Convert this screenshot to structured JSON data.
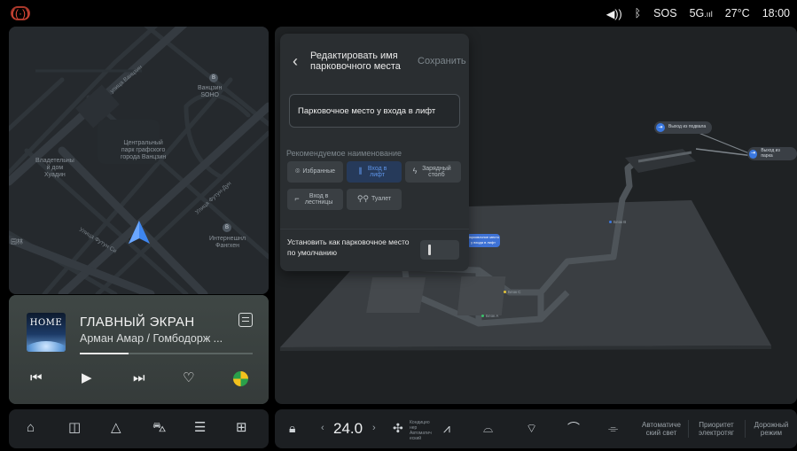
{
  "status": {
    "items": [
      "SOS",
      "5G",
      "27°C",
      "18:00"
    ]
  },
  "map": {
    "labels": {
      "wanjin_street": "улица Ванцзин",
      "soho": "Ванцзин\nSOHO",
      "park": "Центральный\nпарк графского\nгорода Ванцзин",
      "house": "Владетельны\nй дом\nХуадин",
      "futong_rd": "Улица Футун-Дун",
      "futong_west": "Улица Футун Си",
      "international": "Интернешнл\nФангхен",
      "edge_left": "园林"
    }
  },
  "music": {
    "album_text": "HOME",
    "title": "ГЛАВНЫЙ ЭКРАН",
    "artist": "Арман Амар / Гомбодорж ...",
    "progress": 0.28
  },
  "dialog": {
    "title": "Редактировать имя парковочного места",
    "save": "Сохранить",
    "input_value": "Парковочное место у входа в лифт",
    "suggested_heading": "Рекомендуемое наименование",
    "chips": [
      {
        "label": "Избранные",
        "icon": "pin-icon",
        "active": false
      },
      {
        "label": "Вход в лифт",
        "icon": "elevator-icon",
        "active": true
      },
      {
        "label": "Зарядный столб",
        "icon": "charge-icon",
        "active": false
      },
      {
        "label": "Вход в лестницы",
        "icon": "stairs-icon",
        "active": false
      },
      {
        "label": "Туалет",
        "icon": "toilet-icon",
        "active": false
      }
    ],
    "default_label": "Установить как парковочное место по умолчанию"
  },
  "parking_map": {
    "exit_basement": "Выход из подвала",
    "exit_park": "Выход из парка",
    "block_b": "Блок B",
    "block_c": "Блок C",
    "block_a": "Блок A",
    "tooltip": "Парковочное место у входа в лифт"
  },
  "climate": {
    "temperature": "24.0",
    "auto_conditioning": "Кондицио нер Автоматич еский",
    "auto_light": "Автоматиче ский свет",
    "priority": "Приоритет электротяг",
    "road_mode": "Дорожный режим"
  },
  "colors": {
    "accent_blue": "#3a78e0",
    "alert_red": "#e34b3a"
  }
}
